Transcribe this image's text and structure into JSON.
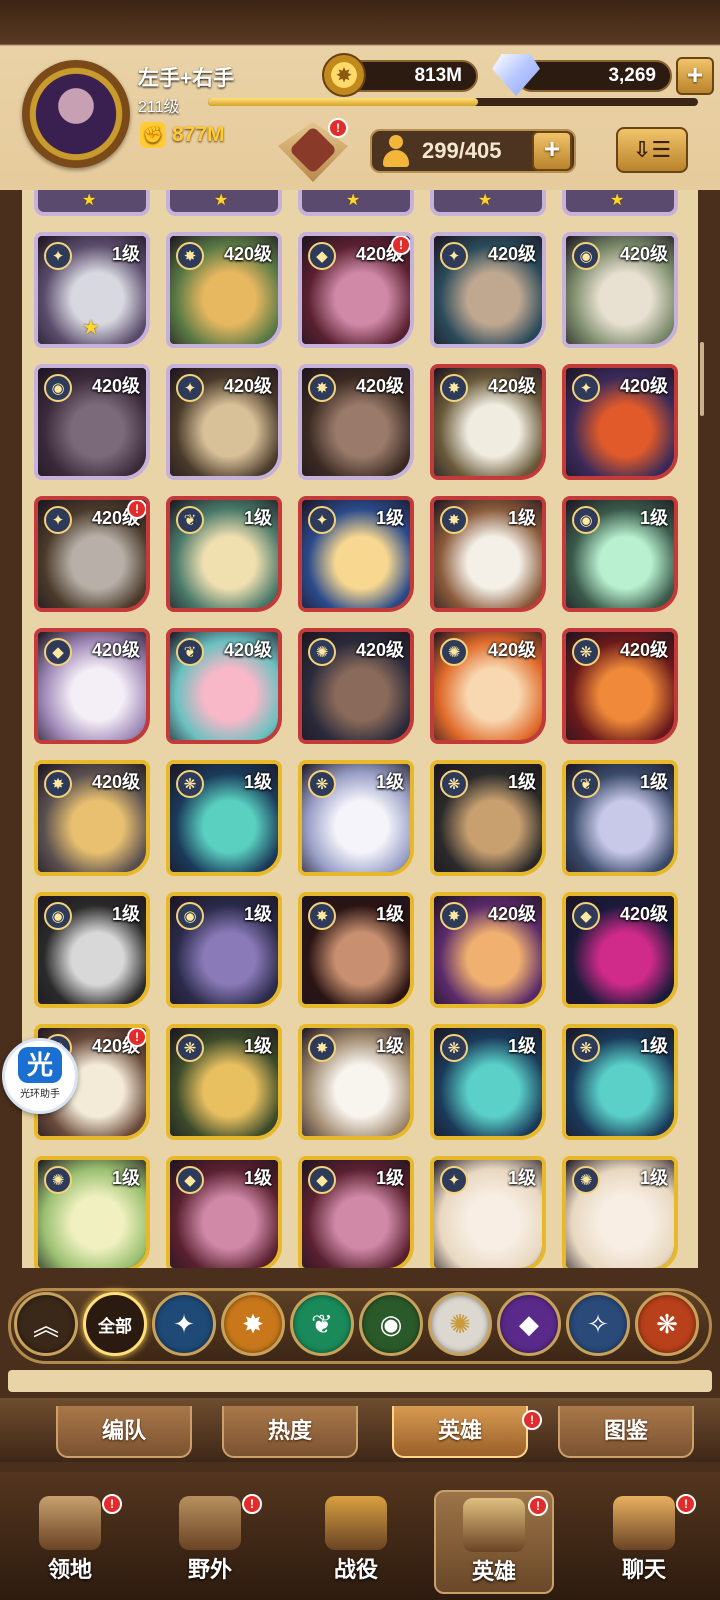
{
  "player": {
    "name": "左手+右手",
    "level": "211级",
    "power": "877M",
    "xp_progress": 0.55
  },
  "resources": {
    "gold": "813M",
    "gems": "3,269"
  },
  "roster": {
    "count": "299/405"
  },
  "faction_symbols": {
    "lightbearer": "✦",
    "mauler": "✸",
    "wilder": "❦",
    "graveborn": "◉",
    "celestial": "✺",
    "hypogean": "◆",
    "dimensional": "✧",
    "dragon": "❋"
  },
  "heroes": [
    {
      "level": "1级",
      "tier": "e",
      "faction": "lightbearer",
      "star": true,
      "badge": false,
      "c1": "#d8d8e0",
      "c2": "#5a4c6c"
    },
    {
      "level": "420级",
      "tier": "e",
      "faction": "mauler",
      "star": false,
      "badge": false,
      "c1": "#e8b860",
      "c2": "#5a7a44"
    },
    {
      "level": "420级",
      "tier": "e",
      "faction": "hypogean",
      "star": false,
      "badge": true,
      "c1": "#d08aa8",
      "c2": "#5a2030"
    },
    {
      "level": "420级",
      "tier": "e",
      "faction": "lightbearer",
      "star": false,
      "badge": false,
      "c1": "#c0a890",
      "c2": "#2a4a5a"
    },
    {
      "level": "420级",
      "tier": "e",
      "faction": "graveborn",
      "star": false,
      "badge": false,
      "c1": "#e8e0d0",
      "c2": "#7a8a6a"
    },
    {
      "level": "420级",
      "tier": "e",
      "faction": "graveborn",
      "star": false,
      "badge": false,
      "c1": "#7a6a7a",
      "c2": "#3a2a3a"
    },
    {
      "level": "420级",
      "tier": "e",
      "faction": "lightbearer",
      "star": false,
      "badge": false,
      "c1": "#d8c098",
      "c2": "#4a3a2a"
    },
    {
      "level": "420级",
      "tier": "e",
      "faction": "mauler",
      "star": false,
      "badge": false,
      "c1": "#9a7a6a",
      "c2": "#3a2a22"
    },
    {
      "level": "420级",
      "tier": "m",
      "faction": "mauler",
      "star": false,
      "badge": false,
      "c1": "#f0ece0",
      "c2": "#6a5a3a"
    },
    {
      "level": "420级",
      "tier": "m",
      "faction": "lightbearer",
      "star": false,
      "badge": false,
      "c1": "#e05a2a",
      "c2": "#3a2a5a"
    },
    {
      "level": "420级",
      "tier": "m",
      "faction": "lightbearer",
      "star": false,
      "badge": true,
      "c1": "#b8b0a8",
      "c2": "#4a3a2a"
    },
    {
      "level": "1级",
      "tier": "m",
      "faction": "wilder",
      "star": false,
      "badge": false,
      "c1": "#f0e0b0",
      "c2": "#4a7a6a"
    },
    {
      "level": "1级",
      "tier": "m",
      "faction": "lightbearer",
      "star": false,
      "badge": false,
      "c1": "#f8d890",
      "c2": "#2a4a8a"
    },
    {
      "level": "1级",
      "tier": "m",
      "faction": "mauler",
      "star": false,
      "badge": false,
      "c1": "#f4f0e8",
      "c2": "#8a5a3a"
    },
    {
      "level": "1级",
      "tier": "m",
      "faction": "graveborn",
      "star": false,
      "badge": false,
      "c1": "#b8f0d0",
      "c2": "#3a5a4a"
    },
    {
      "level": "420级",
      "tier": "m",
      "faction": "hypogean",
      "star": false,
      "badge": false,
      "c1": "#f4eef6",
      "c2": "#a08ab8"
    },
    {
      "level": "420级",
      "tier": "m",
      "faction": "wilder",
      "star": false,
      "badge": false,
      "c1": "#f8b8c8",
      "c2": "#6ac0c0"
    },
    {
      "level": "420级",
      "tier": "m",
      "faction": "celestial",
      "star": false,
      "badge": false,
      "c1": "#8a6a5a",
      "c2": "#2a2a3a"
    },
    {
      "level": "420级",
      "tier": "m",
      "faction": "celestial",
      "star": false,
      "badge": false,
      "c1": "#f8d8b0",
      "c2": "#e06a2a"
    },
    {
      "level": "420级",
      "tier": "m",
      "faction": "dragon",
      "star": false,
      "badge": false,
      "c1": "#f08a3a",
      "c2": "#6a1a1a"
    },
    {
      "level": "420级",
      "tier": "l",
      "faction": "mauler",
      "star": false,
      "badge": false,
      "c1": "#e8c070",
      "c2": "#5a5050"
    },
    {
      "level": "1级",
      "tier": "l",
      "faction": "dragon",
      "star": false,
      "badge": false,
      "c1": "#5ad0c0",
      "c2": "#1a3a5a"
    },
    {
      "level": "1级",
      "tier": "l",
      "faction": "dragon",
      "star": false,
      "badge": false,
      "c1": "#f4f4fa",
      "c2": "#9aa0c8"
    },
    {
      "level": "1级",
      "tier": "l",
      "faction": "dragon",
      "star": false,
      "badge": false,
      "c1": "#c8a070",
      "c2": "#2a2a2a"
    },
    {
      "level": "1级",
      "tier": "l",
      "faction": "wilder",
      "star": false,
      "badge": false,
      "c1": "#c8c8e8",
      "c2": "#3a4a6a"
    },
    {
      "level": "1级",
      "tier": "l",
      "faction": "graveborn",
      "star": false,
      "badge": false,
      "c1": "#d8d8d8",
      "c2": "#2a2a2a"
    },
    {
      "level": "1级",
      "tier": "l",
      "faction": "graveborn",
      "star": false,
      "badge": false,
      "c1": "#8a7ab8",
      "c2": "#2a2a4a"
    },
    {
      "level": "1级",
      "tier": "l",
      "faction": "mauler",
      "star": false,
      "badge": false,
      "c1": "#c89070",
      "c2": "#2a1414"
    },
    {
      "level": "420级",
      "tier": "l",
      "faction": "mauler",
      "star": false,
      "badge": false,
      "c1": "#f0b070",
      "c2": "#5a2a6a"
    },
    {
      "level": "420级",
      "tier": "l",
      "faction": "hypogean",
      "star": false,
      "badge": false,
      "c1": "#d02a8a",
      "c2": "#1a1a3a"
    },
    {
      "level": "420级",
      "tier": "l",
      "faction": "celestial",
      "star": false,
      "badge": true,
      "c1": "#f4ead8",
      "c2": "#6a4a3a"
    },
    {
      "level": "1级",
      "tier": "l",
      "faction": "dragon",
      "star": false,
      "badge": false,
      "c1": "#e8c060",
      "c2": "#3a4a2a"
    },
    {
      "level": "1级",
      "tier": "l",
      "faction": "mauler",
      "star": false,
      "badge": false,
      "c1": "#f8f4ee",
      "c2": "#a08a70"
    },
    {
      "level": "1级",
      "tier": "l",
      "faction": "dragon",
      "star": false,
      "badge": false,
      "c1": "#5ad0c8",
      "c2": "#1a3a5a"
    },
    {
      "level": "1级",
      "tier": "l",
      "faction": "dragon",
      "star": false,
      "badge": false,
      "c1": "#5ad0c8",
      "c2": "#1a3a5a"
    },
    {
      "level": "1级",
      "tier": "l",
      "faction": "celestial",
      "star": false,
      "badge": false,
      "c1": "#f0f0c0",
      "c2": "#9ac070"
    },
    {
      "level": "1级",
      "tier": "l",
      "faction": "hypogean",
      "star": false,
      "badge": false,
      "c1": "#d08aa8",
      "c2": "#5a2030"
    },
    {
      "level": "1级",
      "tier": "l",
      "faction": "hypogean",
      "star": false,
      "badge": false,
      "c1": "#d08aa8",
      "c2": "#5a2030"
    },
    {
      "level": "1级",
      "tier": "l",
      "faction": "lightbearer",
      "star": false,
      "badge": false,
      "c1": "#f8eee4",
      "c2": "#e8d8c0"
    },
    {
      "level": "1级",
      "tier": "l",
      "faction": "celestial",
      "star": false,
      "badge": false,
      "c1": "#f8eee4",
      "c2": "#e8d8c0"
    }
  ],
  "assistant": {
    "glyph": "光",
    "label": "光环助手"
  },
  "filters": [
    {
      "id": "rank",
      "label": "",
      "glyph": "︽",
      "bg": "#3a2818"
    },
    {
      "id": "all",
      "label": "全部",
      "glyph": "",
      "bg": "#2a1a10"
    },
    {
      "id": "lightbearer",
      "label": "",
      "glyph": "✦",
      "bg": "#1f4a78"
    },
    {
      "id": "mauler",
      "label": "",
      "glyph": "✸",
      "bg": "#c8781a"
    },
    {
      "id": "wilder",
      "label": "",
      "glyph": "❦",
      "bg": "#1a8a5a"
    },
    {
      "id": "graveborn",
      "label": "",
      "glyph": "◉",
      "bg": "#2a5a2a"
    },
    {
      "id": "celestial",
      "label": "",
      "glyph": "✺",
      "bg": "#dcd8d0"
    },
    {
      "id": "hypogean",
      "label": "",
      "glyph": "◆",
      "bg": "#5a2a8a"
    },
    {
      "id": "dimensional",
      "label": "",
      "glyph": "✧",
      "bg": "#2a4a7a"
    },
    {
      "id": "dragon",
      "label": "",
      "glyph": "❋",
      "bg": "#b8401a"
    }
  ],
  "subtabs": [
    "编队",
    "热度",
    "英雄",
    "图鉴"
  ],
  "nav": [
    {
      "label": "领地",
      "badge": true,
      "color": "#c8a070"
    },
    {
      "label": "野外",
      "badge": true,
      "color": "#b89060"
    },
    {
      "label": "战役",
      "badge": false,
      "color": "#d8a040"
    },
    {
      "label": "英雄",
      "badge": true,
      "color": "#e0c080"
    },
    {
      "label": "聊天",
      "badge": true,
      "color": "#e8b060"
    }
  ],
  "badge_mark": "!"
}
